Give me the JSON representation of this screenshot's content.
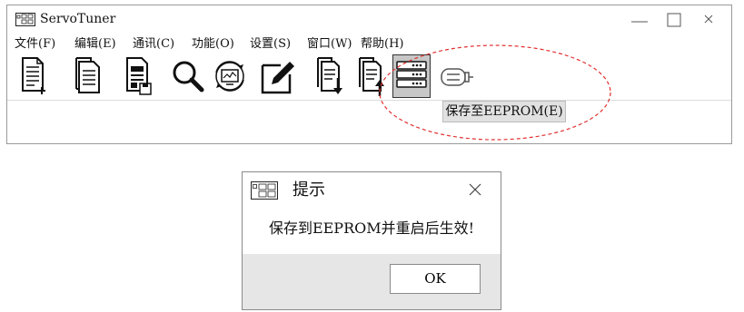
{
  "window": {
    "title": "ServoTuner"
  },
  "menu": [
    {
      "label": "文件(F)"
    },
    {
      "label": "编辑(E)"
    },
    {
      "label": "通讯(C)"
    },
    {
      "label": "功能(O)"
    },
    {
      "label": "设置(S)"
    },
    {
      "label": "窗口(W)"
    },
    {
      "label": "帮助(H)"
    }
  ],
  "toolbar": {
    "icons": [
      "new-file-icon",
      "open-file-icon",
      "save-file-icon",
      "search-icon",
      "monitor-refresh-icon",
      "edit-pencil-icon",
      "download-param-icon",
      "upload-param-icon",
      "save-eeprom-icon",
      "servo-motor-icon"
    ],
    "tooltip": "保存至EEPROM(E)"
  },
  "dialog": {
    "title": "提示",
    "message": "保存到EEPROM并重启后生效!",
    "ok_label": "OK"
  },
  "colors": {
    "highlight_ellipse": "#e23030",
    "dialog_footer": "#e6e6e6",
    "active_tool": "#c7c7c7"
  }
}
